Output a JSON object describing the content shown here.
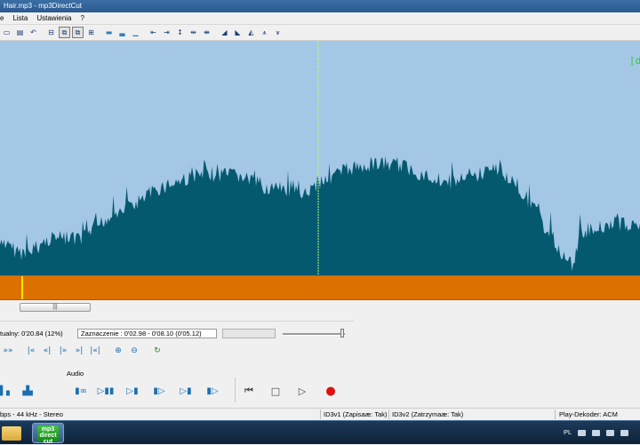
{
  "window": {
    "title": "Hair.mp3 - mp3DirectCut"
  },
  "menu": {
    "items": [
      "e",
      "Lista",
      "Ustawienia",
      "?"
    ]
  },
  "toolbar": {
    "icons": [
      "open-file-icon",
      "save-icon",
      "undo-icon",
      "cut-icon",
      "copy-icon",
      "paste-icon",
      "insert-icon",
      "wave-full-icon",
      "wave-half-icon",
      "wave-low-icon",
      "marker-left-icon",
      "marker-right-icon",
      "marker-set-icon",
      "marker-center-icon",
      "marker-jump-icon",
      "fade-in-icon",
      "fade-out-icon",
      "fade-both-icon",
      "fade-level-icon",
      "normalize-icon"
    ]
  },
  "waveform": {
    "marker_label": "[d"
  },
  "scrollbar": {
    "thumb_glyph": "|||"
  },
  "position": {
    "current_text": "tualny: 0'20.84  (12%)",
    "selection_text": "Zaznaczenie : 0'02.98 - 0'08.10 (0'05.12)"
  },
  "nav_row": {
    "buttons": [
      "»»",
      "|«",
      "«|",
      "|»",
      "»|",
      "|«|",
      "zoom-in",
      "zoom-out",
      "loop"
    ]
  },
  "audio": {
    "label": "Audio"
  },
  "transport": {
    "buttons": [
      "go-start",
      "stop",
      "play",
      "record"
    ]
  },
  "statusbar": {
    "format": "bps - 44 kHz - Stereo",
    "id3v1": "ID3v1 (Zapisaæ: Tak)",
    "id3v2": "ID3v2 (Zatrzymaæ: Tak)",
    "decoder": "Play-Dekoder: ACM"
  },
  "taskbar": {
    "app_logo": "mp3 direct cut",
    "language": "PL"
  },
  "colors": {
    "wave_background": "#a4c7e6",
    "wave_fill": "#04596f",
    "selection_bar": "#dd7100",
    "cursor_line": "#ffe400",
    "marker_green": "#1fd81f"
  }
}
